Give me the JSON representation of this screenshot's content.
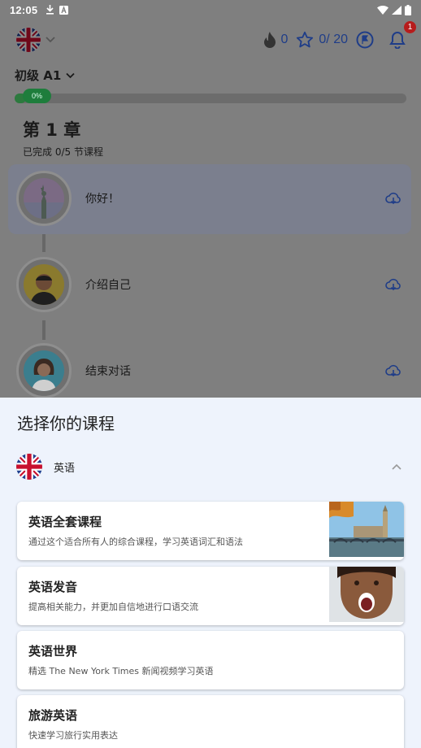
{
  "status_bar": {
    "time": "12:05",
    "icons_left": [
      "download-icon",
      "app-notification-icon"
    ],
    "icons_right": [
      "wifi-icon",
      "signal-icon",
      "battery-icon"
    ]
  },
  "app_bar": {
    "flag": "uk-flag-icon",
    "streak": "0",
    "stars": "0/ 20",
    "notification_count": "1"
  },
  "level": {
    "label": "初级 A1",
    "progress_percent": 0,
    "progress_label": "0%"
  },
  "chapter": {
    "title": "第 1 章",
    "subtitle": "已完成 0/5 节课程"
  },
  "lessons": [
    {
      "label": "你好！",
      "avatar": "statue-of-liberty"
    },
    {
      "label": "介绍自己",
      "avatar": "man-portrait"
    },
    {
      "label": "结束对话",
      "avatar": "woman-portrait"
    }
  ],
  "course_sheet": {
    "title": "选择你的课程",
    "language": "英语",
    "courses": [
      {
        "title": "英语全套课程",
        "desc": "通过这个适合所有人的综合课程，学习英语词汇和语法",
        "thumb": "london-bridge"
      },
      {
        "title": "英语发音",
        "desc": "提高相关能力，并更加自信地进行口语交流",
        "thumb": "woman-shouting"
      },
      {
        "title": "英语世界",
        "desc": "精选 The New York Times 新闻视频学习英语"
      },
      {
        "title": "旅游英语",
        "desc": "快速学习旅行实用表达"
      }
    ]
  },
  "colors": {
    "accent": "#1f3d88",
    "progress_green": "#1e7d3c",
    "badge_red": "#b71c1c",
    "sheet_bg": "#eef3fc",
    "overlay": "#7f7f7f"
  }
}
